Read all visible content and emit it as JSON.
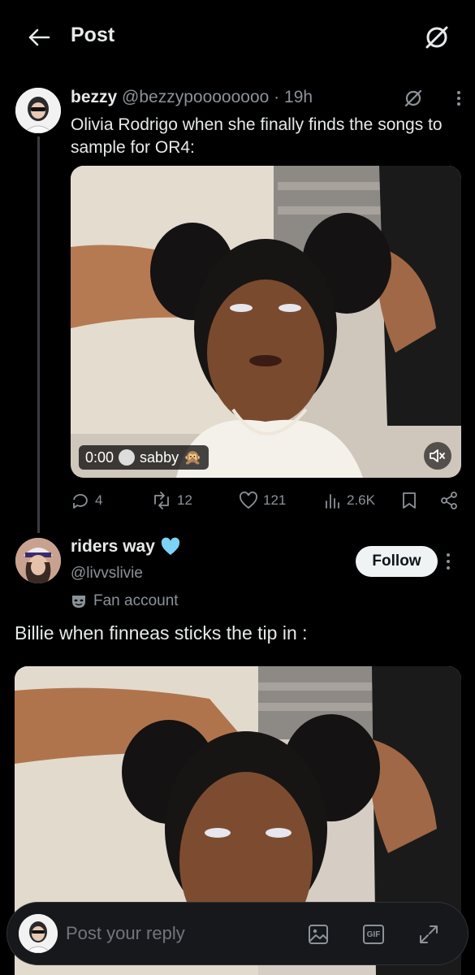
{
  "header": {
    "title": "Post"
  },
  "parent_tweet": {
    "name": "bezzy",
    "handle": "@bezzypoooooooo",
    "separator": "·",
    "time": "19h",
    "text": "Olivia Rodrigo when she finally finds the songs to sample for OR4:",
    "media": {
      "time": "0:00",
      "credit": "sabby",
      "credit_emoji": "🙊"
    },
    "stats": {
      "replies": "4",
      "reposts": "12",
      "likes": "121",
      "views": "2.6K"
    }
  },
  "reply": {
    "name": "riders way",
    "handle": "@livvslivie",
    "badge_label": "Fan account",
    "follow_label": "Follow",
    "text": "Billie when finneas sticks the tip in :"
  },
  "reply_bar": {
    "placeholder": "Post your reply",
    "gif_label": "GIF"
  },
  "colors": {
    "background": "#000000",
    "text": "#e7e9ea",
    "muted": "#8b9299",
    "heart": "#7dd3f5"
  }
}
